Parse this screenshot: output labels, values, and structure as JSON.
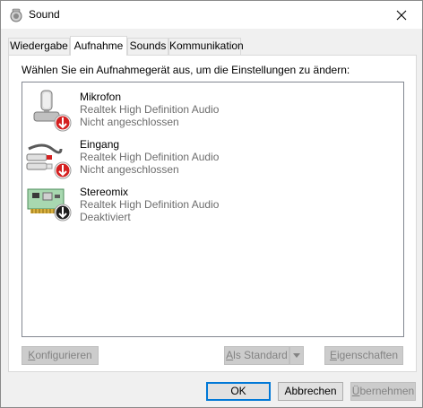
{
  "window": {
    "title": "Sound",
    "icon": "speaker-icon",
    "close_label": "×"
  },
  "tabs": [
    {
      "label": "Wiedergabe",
      "active": false
    },
    {
      "label": "Aufnahme",
      "active": true
    },
    {
      "label": "Sounds",
      "active": false
    },
    {
      "label": "Kommunikation",
      "active": false
    }
  ],
  "panel": {
    "instruction": "Wählen Sie ein Aufnahmegerät aus, um die Einstellungen zu ändern:",
    "devices": [
      {
        "name": "Mikrofon",
        "driver": "Realtek High Definition Audio",
        "status": "Nicht angeschlossen",
        "icon": "microphone-icon",
        "badge": "red-down-arrow-icon"
      },
      {
        "name": "Eingang",
        "driver": "Realtek High Definition Audio",
        "status": "Nicht angeschlossen",
        "icon": "line-in-cable-icon",
        "badge": "red-down-arrow-icon"
      },
      {
        "name": "Stereomix",
        "driver": "Realtek High Definition Audio",
        "status": "Deaktiviert",
        "icon": "sound-card-icon",
        "badge": "black-down-arrow-icon"
      }
    ],
    "buttons": {
      "configure": {
        "accel": "K",
        "rest": "onfigurieren"
      },
      "default": {
        "accel": "A",
        "rest": "ls Standard"
      },
      "properties": {
        "accel": "E",
        "rest": "igenschaften"
      }
    }
  },
  "footer": {
    "ok": "OK",
    "cancel": "Abbrechen",
    "apply": {
      "accel": "Ü",
      "rest": "bernehmen"
    }
  },
  "colors": {
    "accent": "#0078d7",
    "status_red": "#d42020",
    "disabled_text": "#838383",
    "secondary_text": "#6d6d6d"
  }
}
